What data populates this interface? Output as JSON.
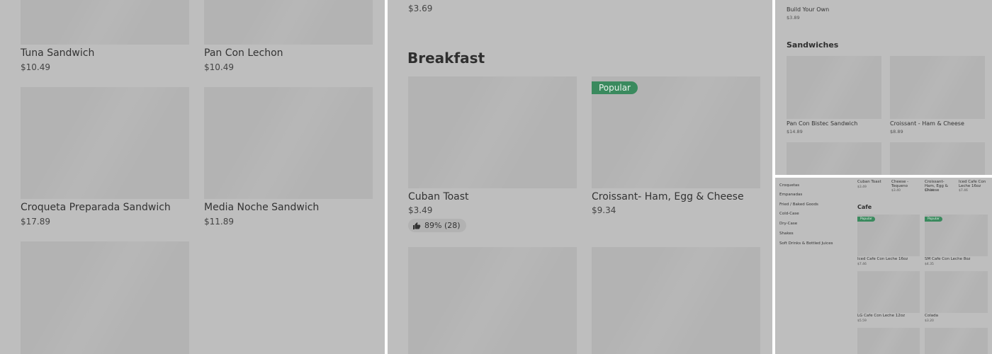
{
  "panel1": {
    "items": [
      {
        "name": "Tuna Sandwich",
        "price": "$10.49"
      },
      {
        "name": "Pan Con Lechon",
        "price": "$10.49"
      },
      {
        "name": "Croqueta Preparada Sandwich",
        "price": "$17.89"
      },
      {
        "name": "Media Noche Sandwich",
        "price": "$11.89"
      }
    ]
  },
  "panel2": {
    "top_price": "$3.69",
    "section_title": "Breakfast",
    "items": [
      {
        "name": "Cuban Toast",
        "price": "$3.49",
        "rating": "89% (28)"
      },
      {
        "name": "Croissant- Ham, Egg & Cheese",
        "price": "$9.34",
        "badge": "Popular"
      }
    ]
  },
  "panel3": {
    "top_item": {
      "name": "Build Your Own",
      "price": "$3.89"
    },
    "section_title": "Sandwiches",
    "items": [
      {
        "name": "Pan Con Bistec Sandwich",
        "price": "$14.89"
      },
      {
        "name": "Croissant - Ham & Cheese",
        "price": "$8.89"
      }
    ]
  },
  "panel4": {
    "categories": [
      "Croquetas",
      "Empanadas",
      "Fried / Baked Goods",
      "Cold-Case",
      "Dry-Case",
      "Shakes",
      "Soft Drinks & Bottled Juices"
    ],
    "top_items": [
      {
        "name": "Cuban Toast",
        "price": "$3.49"
      },
      {
        "name": "Cheese - Tequeno",
        "price": "$3.40"
      },
      {
        "name": "Croissant- Ham, Egg & Cheese",
        "price": "$9.34"
      },
      {
        "name": "Iced Cafe Con Leche 16oz",
        "price": "$7.46"
      }
    ],
    "section_title": "Cafe",
    "badge": "Popular",
    "items": [
      {
        "name": "Iced Cafe Con Leche 16oz",
        "price": "$7.46"
      },
      {
        "name": "SM Cafe Con Leche 8oz",
        "price": "$4.35"
      },
      {
        "name": "LG Cafe Con Leche 12oz",
        "price": "$5.59"
      },
      {
        "name": "Colada",
        "price": "$3.20"
      }
    ]
  },
  "colors": {
    "overlay": "#bebebe",
    "placeholder": "#b3b3b3",
    "badge": "#3a8a5e"
  }
}
